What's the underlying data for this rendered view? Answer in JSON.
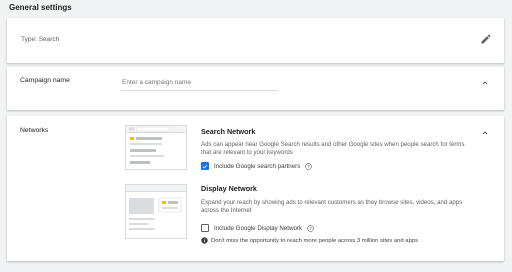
{
  "section_title": "General settings",
  "type_card": {
    "label": "Type: Search",
    "icon": "pencil-icon"
  },
  "campaign_card": {
    "label": "Campaign name",
    "input_placeholder": "Enter a campaign name",
    "input_value": "",
    "icon": "chevron-up-icon"
  },
  "networks_card": {
    "label": "Networks",
    "icon": "chevron-up-icon",
    "search": {
      "title": "Search Network",
      "description": "Ads can appear near Google Search results and other Google sites when people search for terms that are relevant to your keywords",
      "checkbox_label": "Include Google search partners",
      "checked": true
    },
    "display": {
      "title": "Display Network",
      "description": "Expand your reach by showing ads to relevant customers as they browse sites, videos, and apps across the Internet",
      "checkbox_label": "Include Google Display Network",
      "checked": false,
      "info": "Don't miss the opportunity to reach more people across 3 million sites and apps"
    }
  },
  "colors": {
    "accent": "#1a73e8",
    "ad_yellow": "#fbbc04",
    "background": "#f1f3f4"
  }
}
